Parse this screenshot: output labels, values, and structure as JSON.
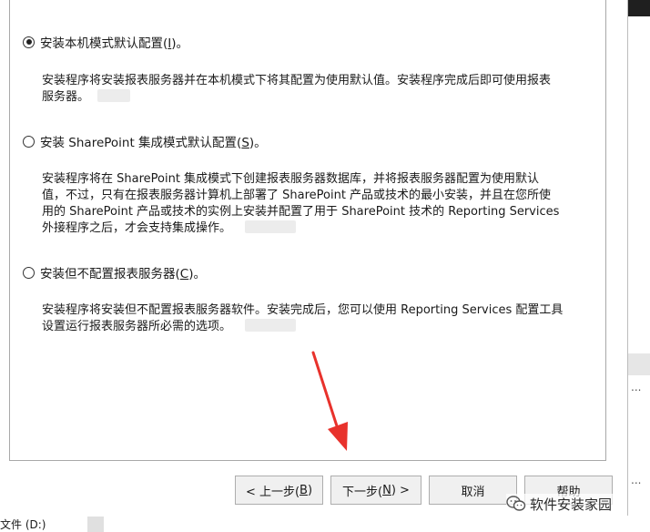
{
  "options": [
    {
      "label_pre": "安装本机模式默认配置(",
      "mnemonic": "I",
      "label_post": ")。",
      "checked": true,
      "desc_lines": [
        "安装程序将安装报表服务器并在本机模式下将其配置为使用默认值。安装程序完成后即可使用报表",
        "服务器。"
      ]
    },
    {
      "label_pre": "安装 SharePoint 集成模式默认配置(",
      "mnemonic": "S",
      "label_post": ")。",
      "checked": false,
      "desc_lines": [
        "安装程序将在 SharePoint 集成模式下创建报表服务器数据库，并将报表服务器配置为使用默认",
        "值，不过，只有在报表服务器计算机上部署了 SharePoint 产品或技术的最小安装，并且在您所使",
        "用的 SharePoint 产品或技术的实例上安装并配置了用于 SharePoint 技术的 Reporting Services",
        "外接程序之后，才会支持集成操作。"
      ]
    },
    {
      "label_pre": "安装但不配置报表服务器(",
      "mnemonic": "C",
      "label_post": ")。",
      "checked": false,
      "desc_lines": [
        "安装程序将安装但不配置报表服务器软件。安装完成后，您可以使用 Reporting Services 配置工具",
        "设置运行报表服务器所必需的选项。"
      ]
    }
  ],
  "buttons": {
    "prev_pre": "< 上一步(",
    "prev_mnemonic": "B",
    "prev_post": ")",
    "next_pre": "下一步(",
    "next_mnemonic": "N",
    "next_post": ") >",
    "cancel": "取消",
    "help": "帮助"
  },
  "watermark": {
    "text": "软件安装家园",
    "icon": "wechat-icon"
  },
  "background": {
    "bottom_text": "文件 (D:)",
    "ellipsis_1": "...",
    "ellipsis_2": "..."
  },
  "colors": {
    "arrow": "#e8322c",
    "button_bg": "#f0f0f0",
    "button_border": "#adadad"
  }
}
